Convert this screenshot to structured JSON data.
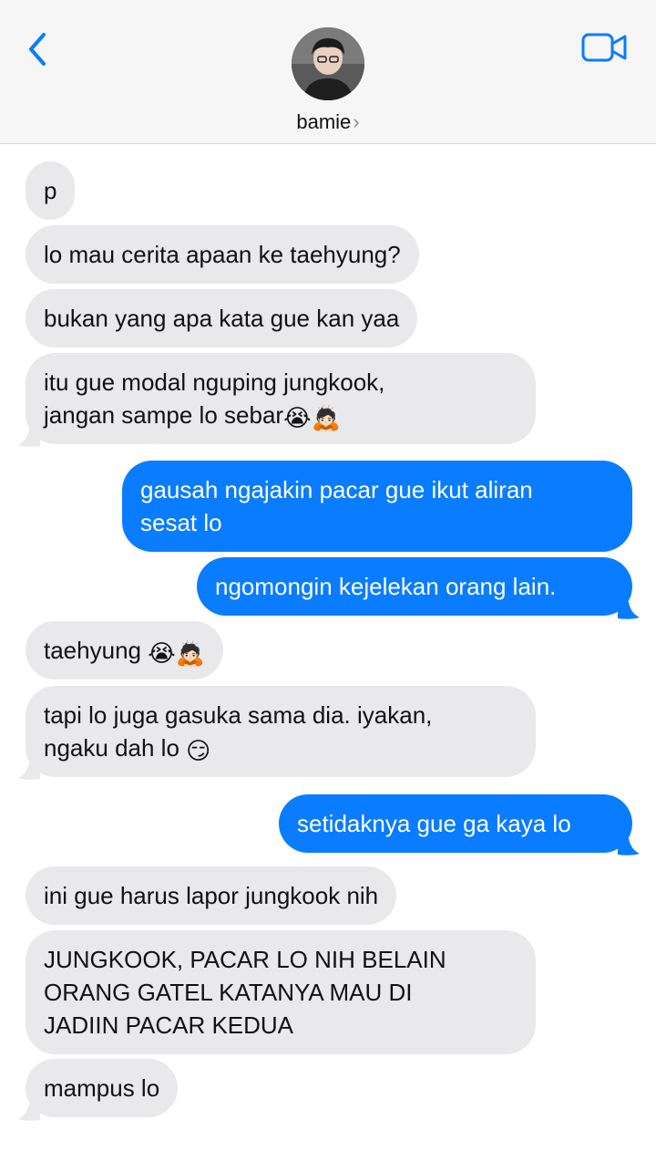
{
  "header": {
    "contact_name": "bamie",
    "chevron": "›",
    "back_icon": "chevron-left-icon",
    "video_icon": "video-camera-icon",
    "accent": "#0a7cff"
  },
  "messages": [
    {
      "from": "them",
      "text": "p"
    },
    {
      "from": "them",
      "text": "lo mau cerita apaan ke taehyung?"
    },
    {
      "from": "them",
      "text": "bukan yang apa kata gue kan yaa"
    },
    {
      "from": "them",
      "lines": [
        "itu gue modal nguping jungkook,",
        "jangan sampe lo sebar"
      ],
      "emojis": [
        "😭",
        "🙇🏻"
      ]
    },
    {
      "from": "me",
      "lines": [
        "gausah ngajakin pacar gue ikut aliran",
        "sesat lo"
      ]
    },
    {
      "from": "me",
      "text": "ngomongin kejelekan orang lain."
    },
    {
      "from": "them",
      "text": "taehyung",
      "emojis": [
        "😭",
        "🙇🏻"
      ]
    },
    {
      "from": "them",
      "lines": [
        "tapi lo juga gasuka sama dia. iyakan,",
        "ngaku dah lo"
      ],
      "emojis": [
        "😏"
      ]
    },
    {
      "from": "me",
      "text": "setidaknya gue ga kaya lo"
    },
    {
      "from": "them",
      "text": "ini gue harus lapor jungkook nih"
    },
    {
      "from": "them",
      "lines": [
        "JUNGKOOK, PACAR LO NIH BELAIN",
        "ORANG GATEL KATANYA MAU DI",
        "JADIIN PACAR KEDUA"
      ]
    },
    {
      "from": "them",
      "text": "mampus lo"
    }
  ]
}
